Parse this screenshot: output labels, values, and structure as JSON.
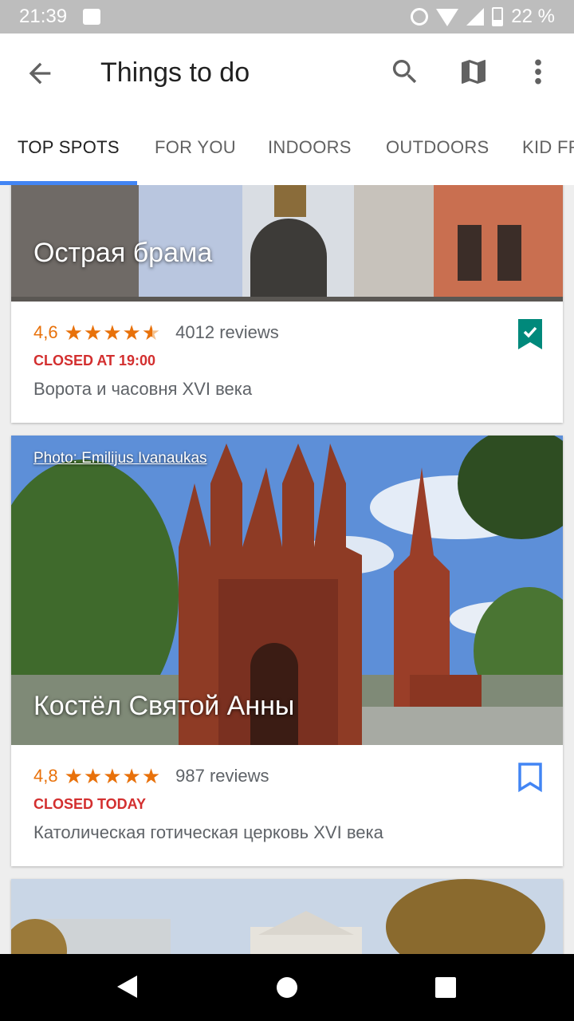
{
  "status_bar": {
    "time": "21:39",
    "battery": "22 %"
  },
  "app_bar": {
    "title": "Things to do"
  },
  "tabs": [
    {
      "label": "TOP SPOTS",
      "active": true
    },
    {
      "label": "FOR YOU",
      "active": false
    },
    {
      "label": "INDOORS",
      "active": false
    },
    {
      "label": "OUTDOORS",
      "active": false
    },
    {
      "label": "KID FR",
      "active": false
    }
  ],
  "cards": [
    {
      "title": "Острая брама",
      "rating": "4,6",
      "stars": "★★★★",
      "reviews": "4012 reviews",
      "status": "CLOSED AT 19:00",
      "description": "Ворота и часовня XVI века",
      "saved": true
    },
    {
      "photo_credit": "Photo: Emilijus Ivanaukas",
      "title": "Костёл Святой Анны",
      "rating": "4,8",
      "stars": "★★★★★",
      "reviews": "987 reviews",
      "status": "CLOSED TODAY",
      "description": "Католическая готическая церковь XVI века",
      "saved": false
    }
  ],
  "colors": {
    "accent": "#4285f4",
    "rating": "#e8710a",
    "closed": "#d32f2f",
    "saved": "#00897b"
  }
}
